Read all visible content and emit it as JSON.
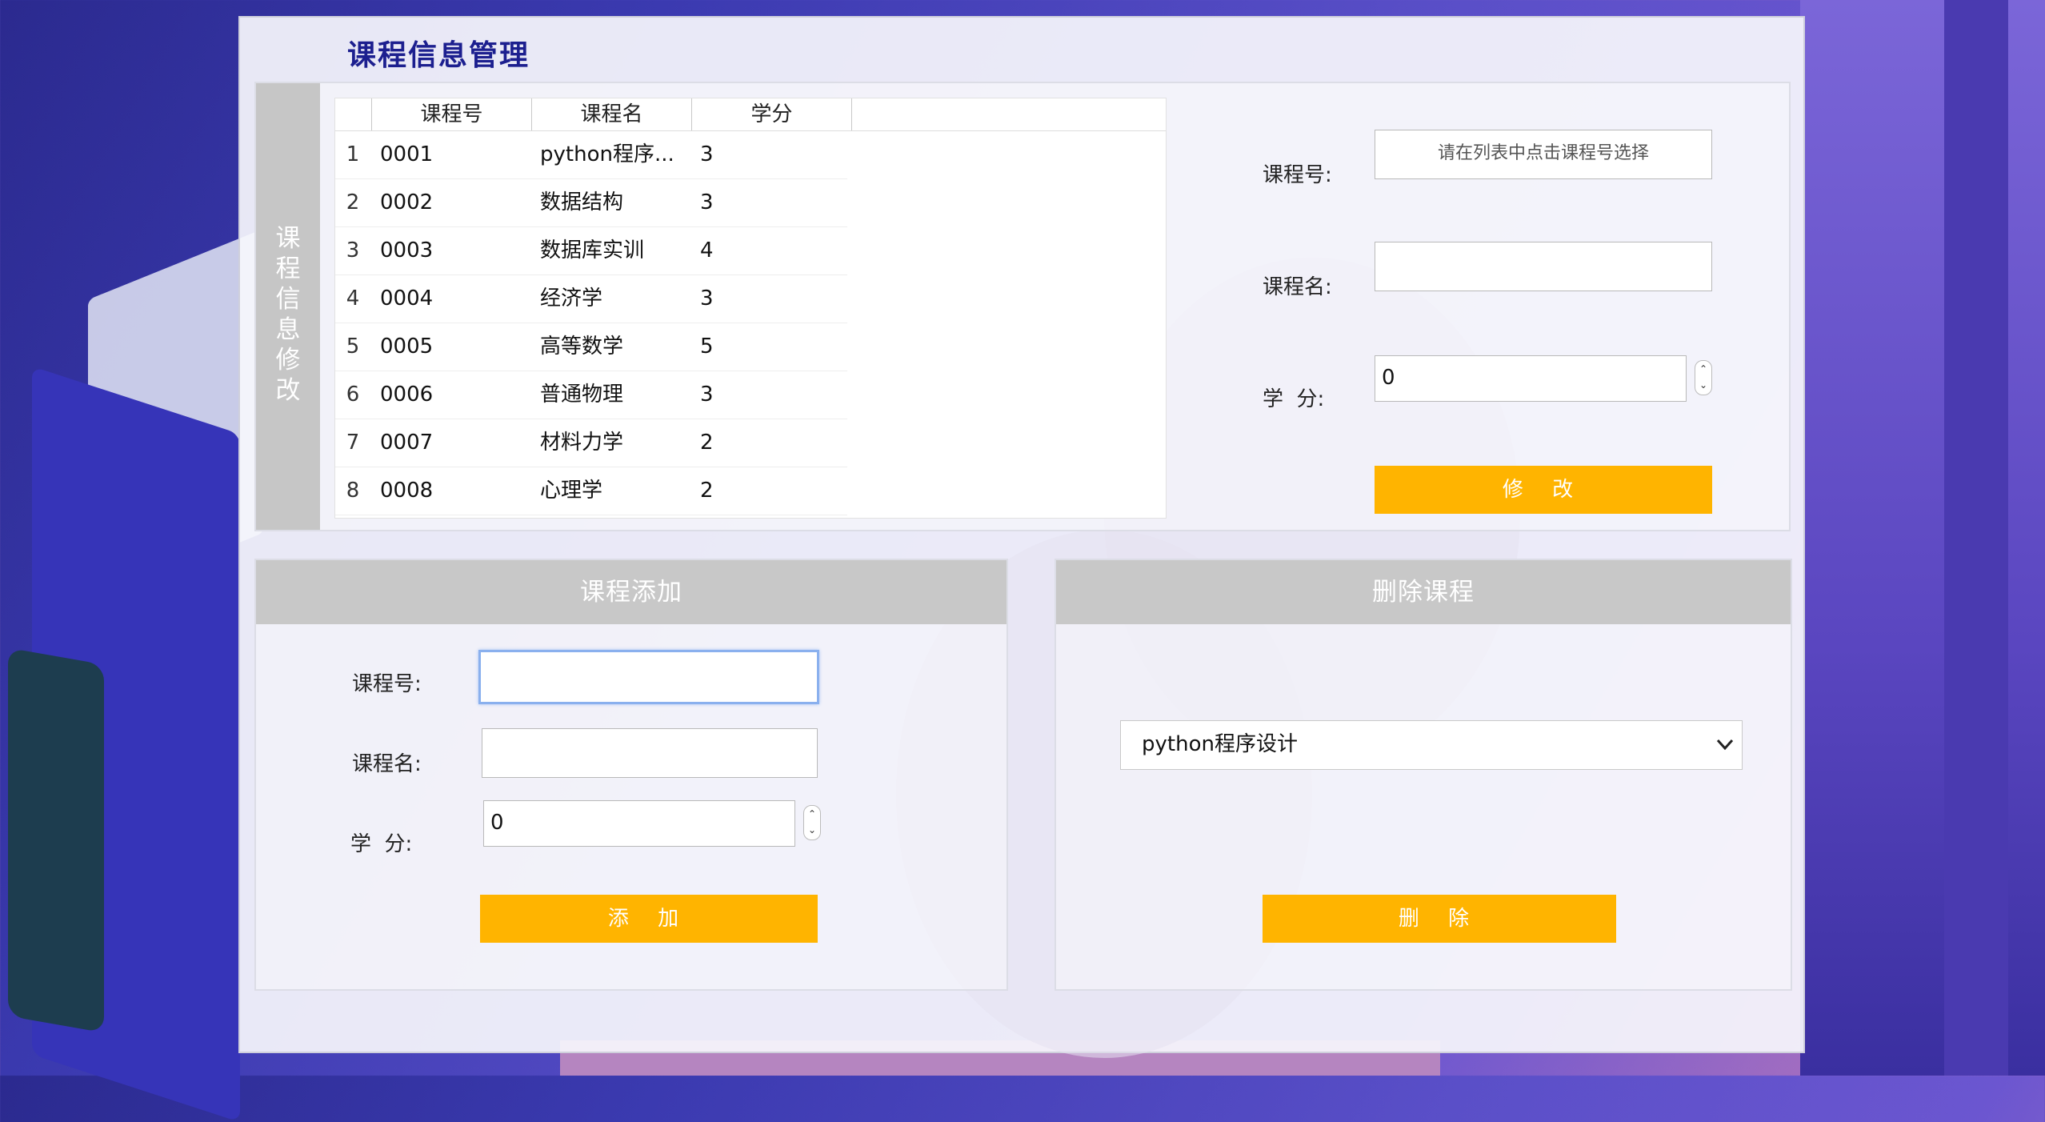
{
  "window": {
    "title": "课程信息管理"
  },
  "edit_panel": {
    "side_label": "课程信息修改",
    "table": {
      "columns": [
        "课程号",
        "课程名",
        "学分"
      ],
      "rows": [
        {
          "num": "1",
          "id": "0001",
          "name": "python程序...",
          "credit": "3"
        },
        {
          "num": "2",
          "id": "0002",
          "name": "数据结构",
          "credit": "3"
        },
        {
          "num": "3",
          "id": "0003",
          "name": "数据库实训",
          "credit": "4"
        },
        {
          "num": "4",
          "id": "0004",
          "name": "经济学",
          "credit": "3"
        },
        {
          "num": "5",
          "id": "0005",
          "name": "高等数学",
          "credit": "5"
        },
        {
          "num": "6",
          "id": "0006",
          "name": "普通物理",
          "credit": "3"
        },
        {
          "num": "7",
          "id": "0007",
          "name": "材料力学",
          "credit": "2"
        },
        {
          "num": "8",
          "id": "0008",
          "name": "心理学",
          "credit": "2"
        }
      ]
    },
    "course_id_label": "课程号:",
    "course_id_placeholder": "请在列表中点击课程号选择",
    "course_name_label": "课程名:",
    "course_name_value": "",
    "credit_label": "学  分:",
    "credit_value": "0",
    "modify_button": "修 改"
  },
  "add_panel": {
    "header": "课程添加",
    "course_id_label": "课程号:",
    "course_id_value": "",
    "course_name_label": "课程名:",
    "course_name_value": "",
    "credit_label": "学  分:",
    "credit_value": "0",
    "add_button": "添  加"
  },
  "delete_panel": {
    "header": "删除课程",
    "selected_course": "python程序设计",
    "delete_button": "删  除"
  },
  "colors": {
    "accent_button": "#ffb400",
    "panel_header": "#c8c8c8",
    "title": "#1c1f8f"
  }
}
